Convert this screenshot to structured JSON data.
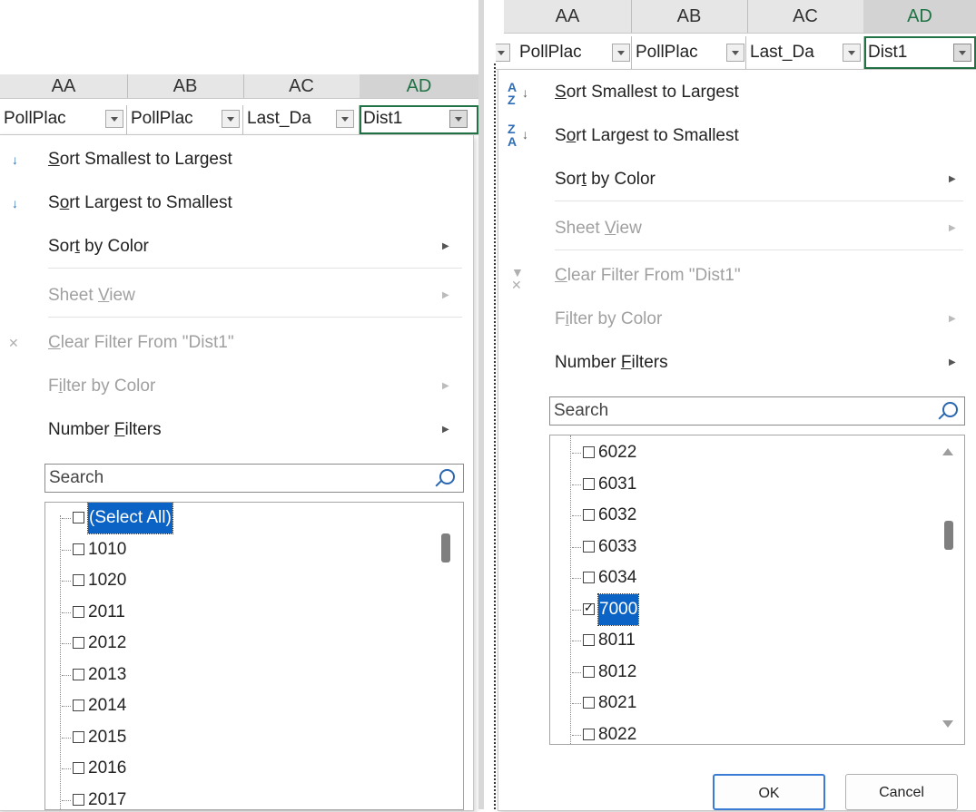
{
  "left": {
    "columns": [
      "AA",
      "AB",
      "AC",
      "AD"
    ],
    "headers": [
      {
        "label": "PollPlac",
        "active": false
      },
      {
        "label": "PollPlac",
        "active": false
      },
      {
        "label": "Last_Da",
        "active": false
      },
      {
        "label": "Dist1",
        "active": true
      }
    ],
    "menu": {
      "sort_asc": {
        "pre": "",
        "u": "S",
        "post": "ort Smallest to Largest"
      },
      "sort_desc": {
        "pre": "S",
        "u": "o",
        "post": "rt Largest to Smallest"
      },
      "sort_color": {
        "pre": "Sor",
        "u": "t",
        "post": " by Color"
      },
      "sheet_view": {
        "pre": "Sheet ",
        "u": "V",
        "post": "iew"
      },
      "clear_filter": {
        "pre": "",
        "u": "C",
        "post": "lear Filter From \"Dist1\""
      },
      "filter_color": {
        "pre": "F",
        "u": "i",
        "post": "lter by Color"
      },
      "number_filters": {
        "pre": "Number ",
        "u": "F",
        "post": "ilters"
      }
    },
    "search_placeholder": "Search",
    "items": [
      {
        "label": "(Select All)",
        "checked": false,
        "selected": true
      },
      {
        "label": "1010",
        "checked": false,
        "selected": false
      },
      {
        "label": "1020",
        "checked": false,
        "selected": false
      },
      {
        "label": "2011",
        "checked": false,
        "selected": false
      },
      {
        "label": "2012",
        "checked": false,
        "selected": false
      },
      {
        "label": "2013",
        "checked": false,
        "selected": false
      },
      {
        "label": "2014",
        "checked": false,
        "selected": false
      },
      {
        "label": "2015",
        "checked": false,
        "selected": false
      },
      {
        "label": "2016",
        "checked": false,
        "selected": false
      },
      {
        "label": "2017",
        "checked": false,
        "selected": false
      }
    ]
  },
  "right": {
    "columns": [
      "AA",
      "AB",
      "AC",
      "AD"
    ],
    "headers": [
      {
        "label": "PollPlac",
        "active": false
      },
      {
        "label": "PollPlac",
        "active": false
      },
      {
        "label": "Last_Da",
        "active": false
      },
      {
        "label": "Dist1",
        "active": true
      }
    ],
    "menu": {
      "sort_asc": {
        "pre": "",
        "u": "S",
        "post": "ort Smallest to Largest"
      },
      "sort_desc": {
        "pre": "S",
        "u": "o",
        "post": "rt Largest to Smallest"
      },
      "sort_color": {
        "pre": "Sor",
        "u": "t",
        "post": " by Color"
      },
      "sheet_view": {
        "pre": "Sheet ",
        "u": "V",
        "post": "iew"
      },
      "clear_filter": {
        "pre": "",
        "u": "C",
        "post": "lear Filter From \"Dist1\""
      },
      "filter_color": {
        "pre": "F",
        "u": "i",
        "post": "lter by Color"
      },
      "number_filters": {
        "pre": "Number ",
        "u": "F",
        "post": "ilters"
      }
    },
    "search_placeholder": "Search",
    "items": [
      {
        "label": "6022",
        "checked": false,
        "selected": false
      },
      {
        "label": "6031",
        "checked": false,
        "selected": false
      },
      {
        "label": "6032",
        "checked": false,
        "selected": false
      },
      {
        "label": "6033",
        "checked": false,
        "selected": false
      },
      {
        "label": "6034",
        "checked": false,
        "selected": false
      },
      {
        "label": "7000",
        "checked": true,
        "selected": true
      },
      {
        "label": "8011",
        "checked": false,
        "selected": false
      },
      {
        "label": "8012",
        "checked": false,
        "selected": false
      },
      {
        "label": "8021",
        "checked": false,
        "selected": false
      },
      {
        "label": "8022",
        "checked": false,
        "selected": false
      }
    ],
    "ok_label": "OK",
    "cancel_label": "Cancel"
  },
  "icons": {
    "sort_asc": "sort-ascending-icon",
    "sort_desc": "sort-descending-icon",
    "clear_filter": "clear-filter-icon",
    "search": "search-icon"
  },
  "colors": {
    "selection": "#0b63c5",
    "excel_green": "#217346",
    "ok_border": "#3a7bd5"
  }
}
